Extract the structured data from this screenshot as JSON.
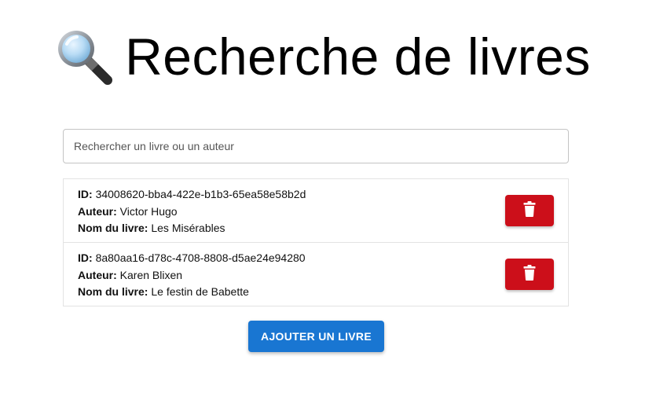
{
  "header": {
    "icon": "magnifying-glass-icon",
    "title": "Recherche de livres"
  },
  "search": {
    "placeholder": "Rechercher un livre ou un auteur",
    "value": ""
  },
  "labels": {
    "id": "ID:",
    "author": "Auteur:",
    "book_name": "Nom du livre:"
  },
  "books": [
    {
      "id": "34008620-bba4-422e-b1b3-65ea58e58b2d",
      "author": "Victor Hugo",
      "name": "Les Misérables",
      "delete_icon": "trash-icon"
    },
    {
      "id": "8a80aa16-d78c-4708-8808-d5ae24e94280",
      "author": "Karen Blixen",
      "name": "Le festin de Babette",
      "delete_icon": "trash-icon"
    }
  ],
  "actions": {
    "add_label": "AJOUTER UN LIVRE"
  },
  "colors": {
    "delete": "#cc0f1a",
    "primary": "#1976d2"
  }
}
